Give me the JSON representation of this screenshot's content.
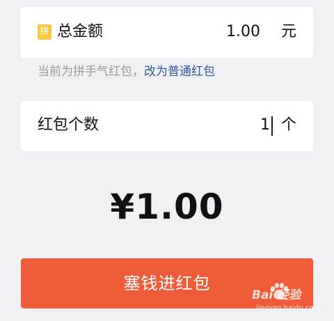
{
  "total_row": {
    "badge": "拼",
    "label": "总金额",
    "value": "1.00",
    "unit": "元"
  },
  "hint": {
    "text": "当前为拼手气红包，",
    "link": "改为普通红包"
  },
  "count_row": {
    "label": "红包个数",
    "value": "1",
    "unit": "个"
  },
  "amount_display": "¥1.00",
  "submit_label": "塞钱进红包",
  "watermark": {
    "brand": "Bai 经验",
    "url": "jingyan.baidu.com"
  },
  "colors": {
    "background": "#efeff4",
    "badge": "#f6c844",
    "link": "#2b5c9a",
    "submit": "#ee5c3a"
  }
}
